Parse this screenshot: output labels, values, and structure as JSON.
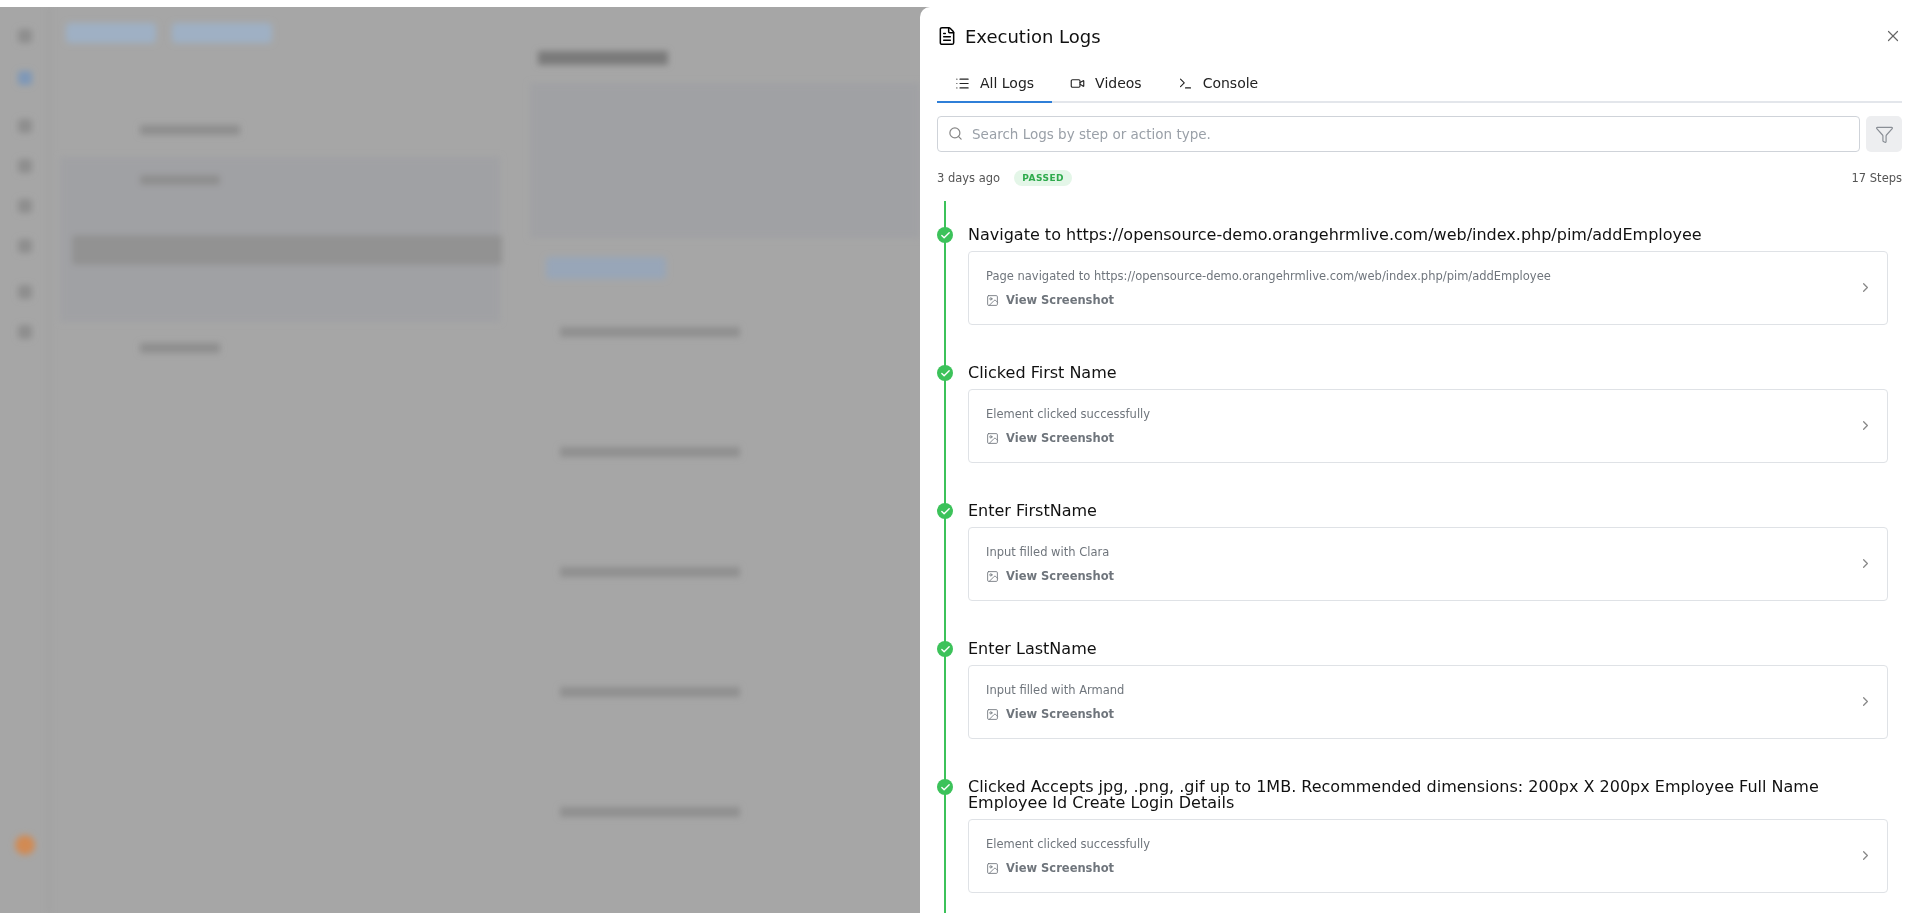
{
  "panel": {
    "title": "Execution Logs",
    "tabs": [
      {
        "label": "All Logs",
        "selected": true
      },
      {
        "label": "Videos",
        "selected": false
      },
      {
        "label": "Console",
        "selected": false
      }
    ],
    "search": {
      "placeholder": "Search Logs by step or action type."
    },
    "run": {
      "time": "3 days ago",
      "status": "PASSED",
      "steps_count": "17 Steps"
    },
    "steps": [
      {
        "title": "Navigate to https://opensource-demo.orangehrmlive.com/web/index.php/pim/addEmployee",
        "message": "Page navigated to https://opensource-demo.orangehrmlive.com/web/index.php/pim/addEmployee",
        "link": "View Screenshot",
        "passed": true
      },
      {
        "title": "Clicked First Name",
        "message": "Element clicked successfully",
        "link": "View Screenshot",
        "passed": true
      },
      {
        "title": "Enter FirstName",
        "message": "Input filled with Clara",
        "link": "View Screenshot",
        "passed": true
      },
      {
        "title": "Enter LastName",
        "message": "Input filled with Armand",
        "link": "View Screenshot",
        "passed": true
      },
      {
        "title": "Clicked Accepts jpg, .png, .gif up to 1MB. Recommended dimensions: 200px X 200px Employee Full Name Employee Id Create Login Details",
        "message": "Element clicked successfully",
        "link": "View Screenshot",
        "passed": true
      }
    ]
  }
}
